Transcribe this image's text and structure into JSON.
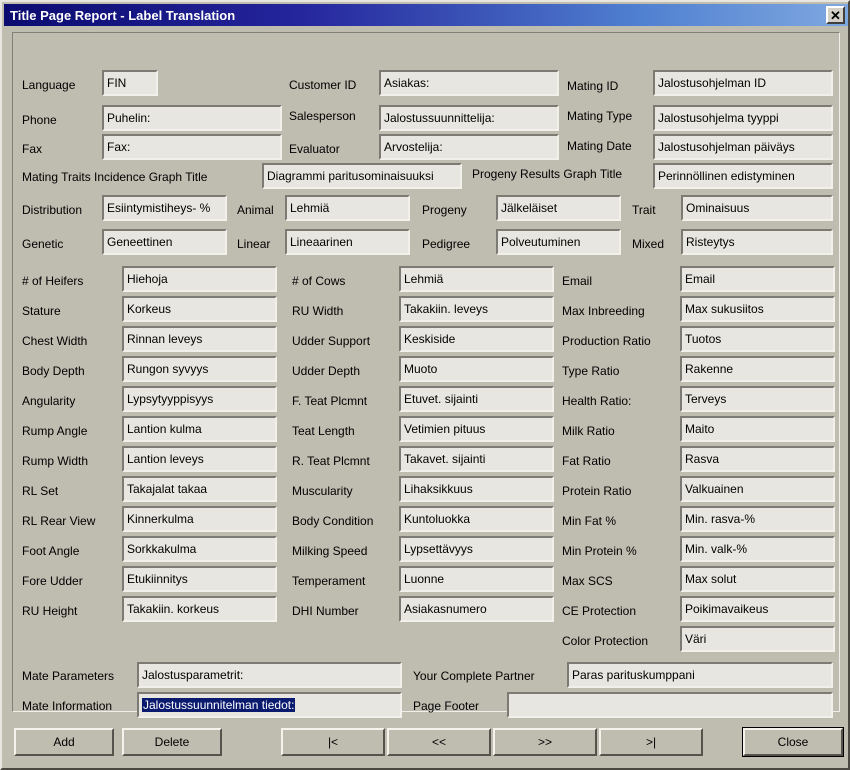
{
  "window": {
    "title": "Title Page Report - Label Translation",
    "close_icon": "close-icon",
    "close_glyph": "✕",
    "titlebar_color_start": "#0b0b70",
    "titlebar_color_end": "#7fa8e0",
    "face_color": "#bfbcb0",
    "field_color": "#e8e6e0",
    "selection_color": "#0a1a6e"
  },
  "header_section": {
    "rows": [
      {
        "label": "Language",
        "value": "FIN"
      },
      {
        "label": "Phone",
        "value": "Puhelin:"
      },
      {
        "label": "Fax",
        "value": "Fax:"
      }
    ],
    "rows_mid": [
      {
        "label": "Customer ID",
        "value": "Asiakas:"
      },
      {
        "label": "Salesperson",
        "value": "Jalostussuunnittelija:"
      },
      {
        "label": "Evaluator",
        "value": "Arvostelija:"
      }
    ],
    "rows_right": [
      {
        "label": "Mating ID",
        "value": "Jalostusohjelman ID"
      },
      {
        "label": "Mating Type",
        "value": "Jalostusohjelma tyyppi"
      },
      {
        "label": "Mating Date",
        "value": "Jalostusohjelman päiväys"
      }
    ]
  },
  "graph_titles": {
    "mating_traits_label": "Mating Traits Incidence Graph Title",
    "mating_traits_value": "Diagrammi paritusominaisuuksi",
    "progeny_results_label": "Progeny Results Graph Title",
    "progeny_results_value": "Perinnöllinen edistyminen"
  },
  "type_section": {
    "left": [
      {
        "label": "Distribution",
        "value": "Esiintymistiheys- %"
      },
      {
        "label": "Genetic",
        "value": "Geneettinen"
      }
    ],
    "mid": [
      {
        "label": "Animal",
        "value": "Lehmiä"
      },
      {
        "label": "Linear",
        "value": "Lineaarinen"
      }
    ],
    "mid2": [
      {
        "label": "Progeny",
        "value": "Jälkeläiset"
      },
      {
        "label": "Pedigree",
        "value": "Polveutuminen"
      }
    ],
    "right": [
      {
        "label": "Trait",
        "value": "Ominaisuus"
      },
      {
        "label": "Mixed",
        "value": "Risteytys"
      }
    ]
  },
  "traits": {
    "column1": [
      {
        "label": "# of Heifers",
        "value": "Hiehoja"
      },
      {
        "label": "Stature",
        "value": "Korkeus"
      },
      {
        "label": "Chest Width",
        "value": "Rinnan leveys"
      },
      {
        "label": "Body Depth",
        "value": "Rungon syvyys"
      },
      {
        "label": "Angularity",
        "value": "Lypsytyyppisyys"
      },
      {
        "label": "Rump Angle",
        "value": "Lantion kulma"
      },
      {
        "label": "Rump Width",
        "value": "Lantion leveys"
      },
      {
        "label": "RL Set",
        "value": "Takajalat takaa"
      },
      {
        "label": "RL Rear View",
        "value": "Kinnerkulma"
      },
      {
        "label": "Foot Angle",
        "value": "Sorkkakulma"
      },
      {
        "label": "Fore Udder",
        "value": "Etukiinnitys"
      },
      {
        "label": "RU Height",
        "value": "Takakiin. korkeus"
      }
    ],
    "column2": [
      {
        "label": "# of Cows",
        "value": "Lehmiä"
      },
      {
        "label": "RU Width",
        "value": "Takakiin. leveys"
      },
      {
        "label": "Udder Support",
        "value": "Keskiside"
      },
      {
        "label": "Udder Depth",
        "value": "Muoto"
      },
      {
        "label": "F. Teat Plcmnt",
        "value": "Etuvet. sijainti"
      },
      {
        "label": "Teat Length",
        "value": "Vetimien pituus"
      },
      {
        "label": "R. Teat Plcmnt",
        "value": "Takavet. sijainti"
      },
      {
        "label": "Muscularity",
        "value": "Lihaksikkuus"
      },
      {
        "label": "Body Condition",
        "value": "Kuntoluokka"
      },
      {
        "label": "Milking Speed",
        "value": "Lypsettävyys"
      },
      {
        "label": "Temperament",
        "value": "Luonne"
      },
      {
        "label": "DHI Number",
        "value": "Asiakasnumero"
      }
    ],
    "column3": [
      {
        "label": "Email",
        "value": "Email"
      },
      {
        "label": "Max Inbreeding",
        "value": "Max sukusiitos"
      },
      {
        "label": "Production Ratio",
        "value": "Tuotos"
      },
      {
        "label": "Type Ratio",
        "value": "Rakenne"
      },
      {
        "label": "Health Ratio:",
        "value": "Terveys"
      },
      {
        "label": "Milk Ratio",
        "value": "Maito"
      },
      {
        "label": "Fat Ratio",
        "value": "Rasva"
      },
      {
        "label": "Protein Ratio",
        "value": "Valkuainen"
      },
      {
        "label": "Min Fat %",
        "value": "Min. rasva-%"
      },
      {
        "label": "Min Protein %",
        "value": "Min. valk-%"
      },
      {
        "label": "Max SCS",
        "value": "Max solut"
      },
      {
        "label": "CE Protection",
        "value": "Poikimavaikeus"
      },
      {
        "label": "Color Protection",
        "value": "Väri"
      }
    ]
  },
  "bottom_section": {
    "mate_parameters_label": "Mate Parameters",
    "mate_parameters_value": "Jalostusparametrit:",
    "mate_information_label": "Mate Information",
    "mate_information_value": "Jalostussuunnitelman tiedot:",
    "mate_information_selected": true,
    "partner_label": "Your Complete Partner",
    "partner_value": "Paras parituskumppani",
    "page_footer_label": "Page Footer",
    "page_footer_value": ""
  },
  "footer": {
    "add": "Add",
    "delete": "Delete",
    "first": "|<",
    "prev": "<<",
    "next": ">>",
    "last": ">|",
    "close": "Close"
  }
}
